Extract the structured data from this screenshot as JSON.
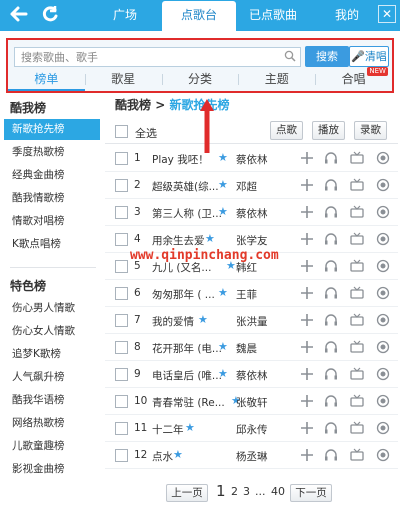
{
  "topbar": {
    "back_icon": "back-arrow-icon",
    "refresh_icon": "refresh-icon",
    "tabs": [
      {
        "label": "广场",
        "active": false
      },
      {
        "label": "点歌台",
        "active": true
      },
      {
        "label": "已点歌曲",
        "active": false
      },
      {
        "label": "我的",
        "active": false
      }
    ],
    "close_icon": "close-icon",
    "bar_color": "#2ca7e3"
  },
  "search": {
    "placeholder": "搜索歌曲、歌手",
    "value": "",
    "search_label": "搜索",
    "sing_label": "清唱"
  },
  "categories": [
    {
      "label": "榜单",
      "active": true
    },
    {
      "label": "歌星",
      "active": false
    },
    {
      "label": "分类",
      "active": false
    },
    {
      "label": "主题",
      "active": false
    },
    {
      "label": "合唱",
      "active": false,
      "badge": "NEW"
    }
  ],
  "sidebar": {
    "section1": {
      "title": "酷我榜",
      "items": [
        {
          "label": "新歌抢先榜",
          "active": true
        },
        {
          "label": "季度热歌榜",
          "active": false
        },
        {
          "label": "经典金曲榜",
          "active": false
        },
        {
          "label": "酷我情歌榜",
          "active": false
        },
        {
          "label": "情歌对唱榜",
          "active": false
        },
        {
          "label": "K歌点唱榜",
          "active": false
        }
      ]
    },
    "section2": {
      "title": "特色榜",
      "items": [
        {
          "label": "伤心男人情歌"
        },
        {
          "label": "伤心女人情歌"
        },
        {
          "label": "追梦K歌榜"
        },
        {
          "label": "人气飙升榜"
        },
        {
          "label": "酷我华语榜"
        },
        {
          "label": "网络热歌榜"
        },
        {
          "label": "儿歌童趣榜"
        },
        {
          "label": "影视金曲榜"
        }
      ]
    }
  },
  "breadcrumb": {
    "parent": "酷我榜",
    "separator": ">",
    "current": "新歌抢先榜"
  },
  "list_header": {
    "select_all": "全选",
    "order_btn": "点歌",
    "play_btn": "播放",
    "record_btn": "录歌"
  },
  "songs": [
    {
      "num": "1",
      "title": "Play 我呸！",
      "artist": "蔡依林"
    },
    {
      "num": "2",
      "title": "超级英雄(综...",
      "artist": "邓超"
    },
    {
      "num": "3",
      "title": "第三人称 (卫...",
      "artist": "蔡依林"
    },
    {
      "num": "4",
      "title": "用余生去爱",
      "artist": "张学友"
    },
    {
      "num": "5",
      "title": "九儿 (又名...",
      "artist": "韩红"
    },
    {
      "num": "6",
      "title": "匆匆那年 ( ...",
      "artist": "王菲"
    },
    {
      "num": "7",
      "title": "我的爱情",
      "artist": "张洪量"
    },
    {
      "num": "8",
      "title": "花开那年 (电...",
      "artist": "魏晨"
    },
    {
      "num": "9",
      "title": "电话皇后 (唯...",
      "artist": "蔡依林"
    },
    {
      "num": "10",
      "title": "青春常驻 (Re...",
      "artist": "张敬轩"
    },
    {
      "num": "11",
      "title": "十二年",
      "artist": "邱永传"
    },
    {
      "num": "12",
      "title": "点水",
      "artist": "杨丞琳"
    }
  ],
  "row_actions": [
    "add-icon",
    "headphones-icon",
    "mv-tv-icon",
    "sing-record-icon"
  ],
  "pagination": {
    "prev": "上一页",
    "pages": [
      "1",
      "2",
      "3"
    ],
    "ellipsis": "...",
    "last": "40",
    "next": "下一页",
    "current": "1"
  },
  "watermark": "www.qinpinchang.com",
  "accent_color": "#2ca7e3",
  "highlight_color": "#e02b2b"
}
